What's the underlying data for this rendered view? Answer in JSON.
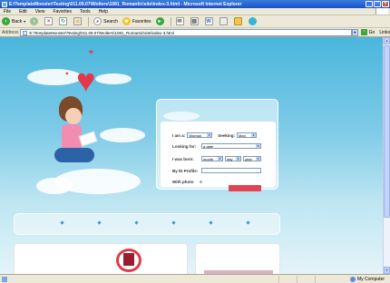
{
  "window": {
    "title": "E:\\TemplateMonster\\Testing\\011.09.07\\Wolters\\1081_Romantic\\site\\index-3.html - Microsoft Internet Explorer"
  },
  "menu": [
    "File",
    "Edit",
    "View",
    "Favorites",
    "Tools",
    "Help"
  ],
  "toolbar": {
    "back": "Back",
    "search": "Search",
    "favorites": "Favorites"
  },
  "address": {
    "label": "Address",
    "value": "E:\\TemplateMonster\\Testing\\011.09.07\\Wolters\\1081_Romantic\\site\\index-3.html",
    "go": "Go",
    "links": "Links"
  },
  "form": {
    "i_am_label": "I am a:",
    "i_am_value": "Woman",
    "seeking_label": "Seeking:",
    "seeking_value": "Man",
    "looking_for_label": "Looking for:",
    "looking_for_value": "a date",
    "born_label": "I was born:",
    "born_month": "month",
    "born_day": "day",
    "born_year": "year",
    "id_label": "By ID Profile:",
    "photo_label": "With photo"
  },
  "status": {
    "zone": "My Computer"
  },
  "colors": {
    "accent": "#e2384a",
    "sky": "#4ab6dc",
    "titlebar": "#1a52c4"
  }
}
